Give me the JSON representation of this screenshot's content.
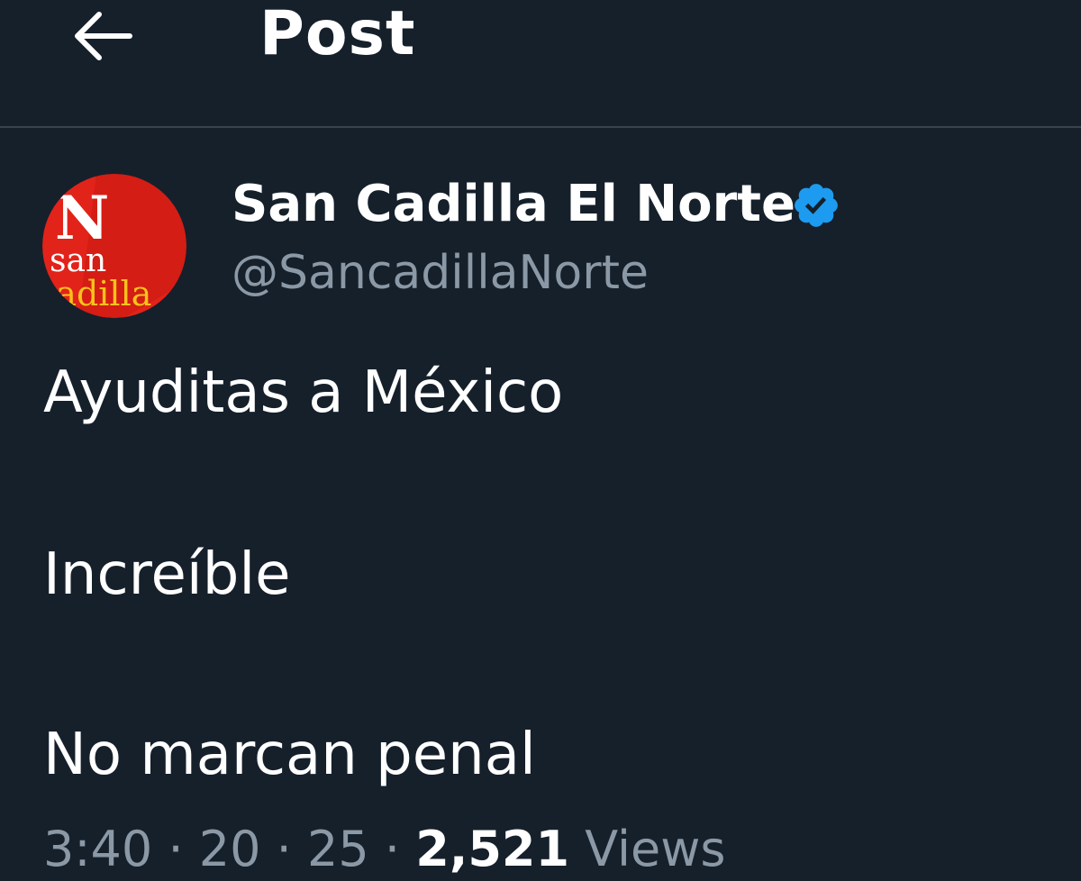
{
  "header": {
    "back_icon": "arrow-left-icon",
    "title": "Post"
  },
  "author": {
    "avatar_text_top": "N",
    "avatar_text_middle": "san",
    "avatar_text_bottom": "cadilla",
    "name": "San Cadilla El Norte",
    "verified_icon": "verified-badge-icon",
    "handle": "@SancadillaNorte"
  },
  "post": {
    "lines": [
      "Ayuditas a México",
      "Increíble",
      "No marcan penal"
    ]
  },
  "meta": {
    "time": "3:40",
    "date": "20",
    "year": "25",
    "views_count": "2,521",
    "views_label": "Views"
  },
  "colors": {
    "background": "#15202b",
    "divider": "#38444d",
    "secondary_text": "#8b98a5",
    "verified_blue": "#1d9bf0",
    "avatar_red": "#e2231a"
  }
}
